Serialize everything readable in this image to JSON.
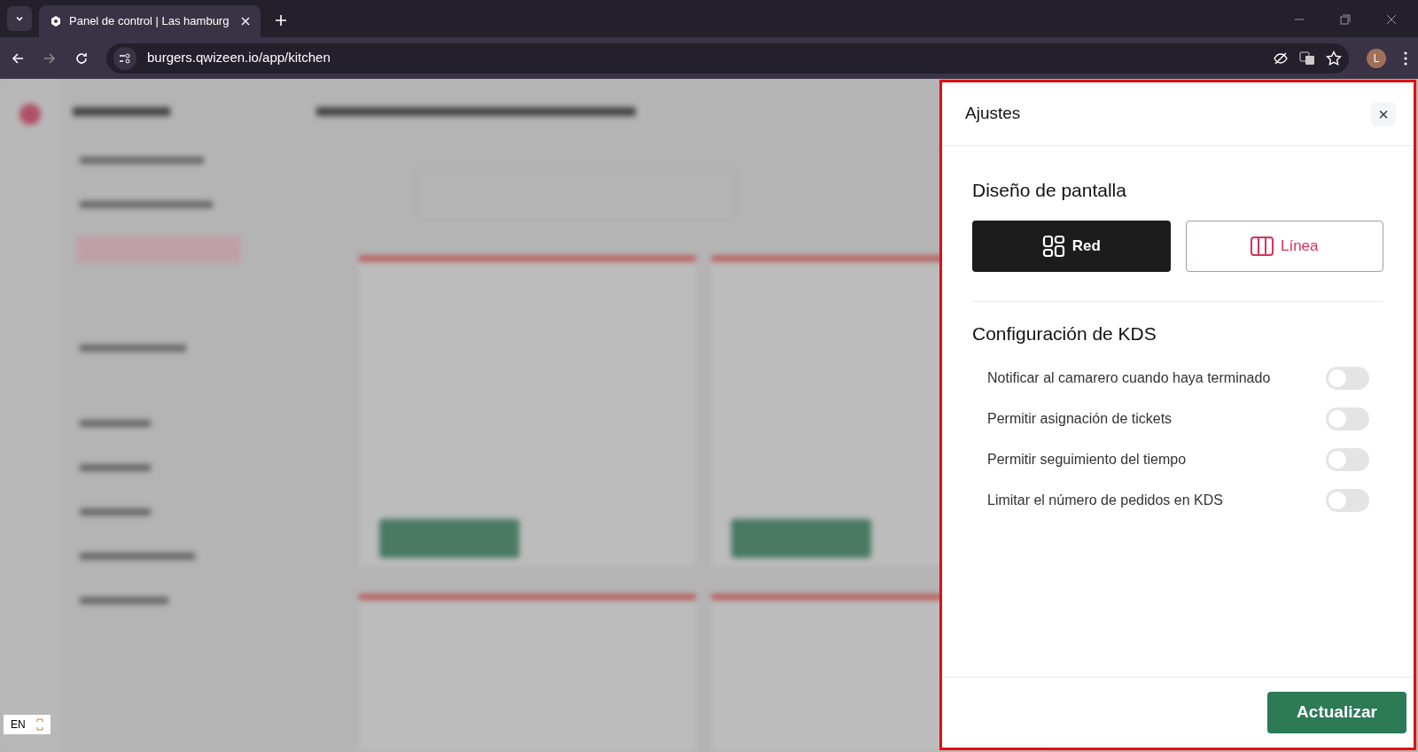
{
  "browser": {
    "tab_title": "Panel de control | Las hamburg",
    "url": "burgers.qwizeen.io/app/kitchen",
    "profile_initial": "L"
  },
  "settings_panel": {
    "title": "Ajustes",
    "close": "×",
    "layout_section": {
      "title": "Diseño de pantalla",
      "options": [
        {
          "label": "Red",
          "kind": "grid",
          "selected": true
        },
        {
          "label": "Línea",
          "kind": "columns",
          "selected": false
        }
      ]
    },
    "kds_section": {
      "title": "Configuración de KDS",
      "settings": [
        {
          "label": "Notificar al camarero cuando haya terminado",
          "on": false
        },
        {
          "label": "Permitir asignación de tickets",
          "on": false
        },
        {
          "label": "Permitir seguimiento del tiempo",
          "on": false
        },
        {
          "label": "Limitar el número de pedidos en KDS",
          "on": false
        }
      ]
    },
    "submit": "Actualizar"
  },
  "language_widget": {
    "label": "EN"
  }
}
